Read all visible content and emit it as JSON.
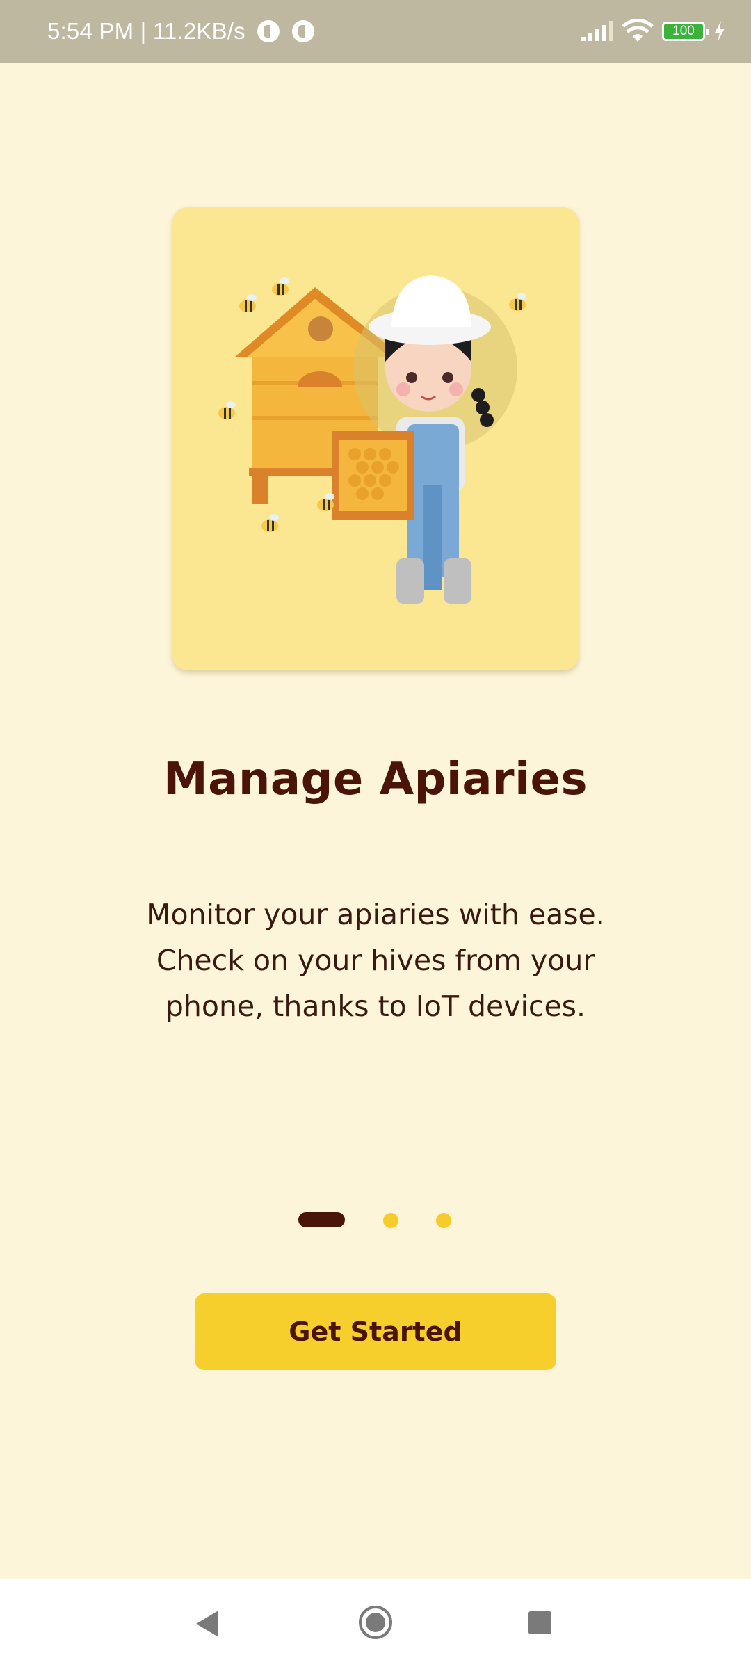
{
  "status_bar": {
    "time": "5:54 PM | 11.2KB/s",
    "battery_level": "100",
    "icons": [
      "app-icon",
      "app-icon",
      "signal-icon",
      "wifi-icon",
      "battery-icon",
      "charging-icon"
    ]
  },
  "onboarding": {
    "title": "Manage Apiaries",
    "description": "Monitor your apiaries with ease. Check on your hives from your phone, thanks to IoT devices.",
    "illustration": "beekeeper-with-hive-illustration",
    "pager": {
      "current_page": 1,
      "total_pages": 3
    },
    "cta_label": "Get Started"
  },
  "colors": {
    "background": "#fdf5d9",
    "card": "#fbe692",
    "accent": "#f7cf2d",
    "text_dark": "#4a1408"
  },
  "nav_bar": {
    "icons": [
      "back-icon",
      "home-icon",
      "recents-icon"
    ]
  }
}
